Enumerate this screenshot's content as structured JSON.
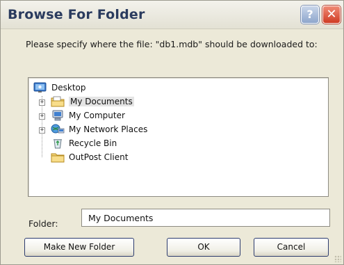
{
  "window": {
    "title": "Browse For Folder",
    "help_glyph": "?",
    "close_glyph": "✕"
  },
  "prompt_text": "Please specify where the file: \"db1.mdb\" should be downloaded to:",
  "tree": {
    "root": {
      "label": "Desktop",
      "icon": "desktop-icon"
    },
    "items": [
      {
        "label": "My Documents",
        "icon": "my-documents-folder-icon",
        "expandable": true,
        "selected": true
      },
      {
        "label": "My Computer",
        "icon": "my-computer-icon",
        "expandable": true,
        "selected": false
      },
      {
        "label": "My Network Places",
        "icon": "network-places-icon",
        "expandable": true,
        "selected": false
      },
      {
        "label": "Recycle Bin",
        "icon": "recycle-bin-icon",
        "expandable": false,
        "selected": false
      },
      {
        "label": "OutPost Client",
        "icon": "folder-icon",
        "expandable": false,
        "selected": false
      }
    ],
    "expand_glyph": "+"
  },
  "folder": {
    "label": "Folder:",
    "value": "My Documents"
  },
  "buttons": {
    "make_new_folder": "Make New Folder",
    "ok": "OK",
    "cancel": "Cancel"
  },
  "colors": {
    "dialog_bg": "#ece9d8",
    "title_text": "#2a3b5e",
    "close_button": "#cf3b23",
    "help_button": "#8ea6cc",
    "button_border": "#2c3b6e"
  }
}
